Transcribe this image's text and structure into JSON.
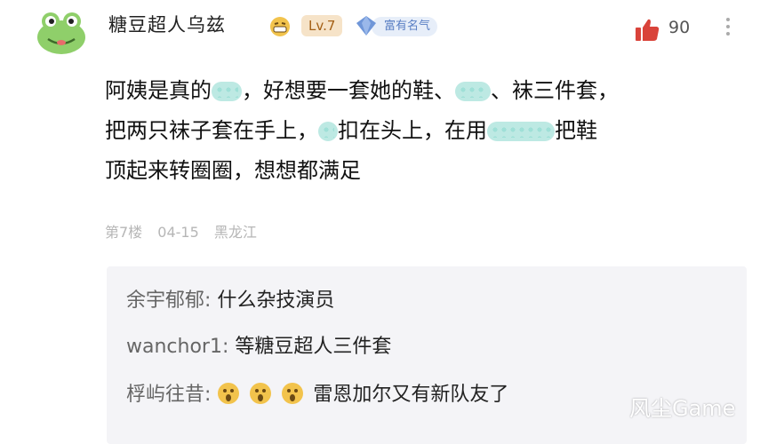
{
  "post": {
    "username": "糖豆超人乌兹",
    "level": "Lv.7",
    "fame_badge": "富有名气",
    "like_count": "90",
    "content_lines": [
      [
        "阿姨是真的",
        "，好想要一套她的鞋、",
        "、袜三件套，"
      ],
      [
        "把两只袜子套在手上，",
        "扣在头上，在用",
        "把鞋"
      ],
      [
        "顶起来转圈圈，想想都满足"
      ]
    ],
    "floor": "第7楼",
    "date": "04-15",
    "location": "黑龙江"
  },
  "replies": [
    {
      "user": "余宇郁郁:",
      "text": "什么杂技演员"
    },
    {
      "user": "wanchor1:",
      "text": "等糖豆超人三件套"
    },
    {
      "user": "桴屿往昔:",
      "text": "雷恩加尔又有新队友了"
    }
  ],
  "watermark": "风尘Game",
  "colors": {
    "like_red": "#d9433a",
    "level_bg": "#f6e3c8",
    "level_text": "#a35f14",
    "fame_blue": "#5a7fc4",
    "reply_bg": "#f4f4f7"
  }
}
